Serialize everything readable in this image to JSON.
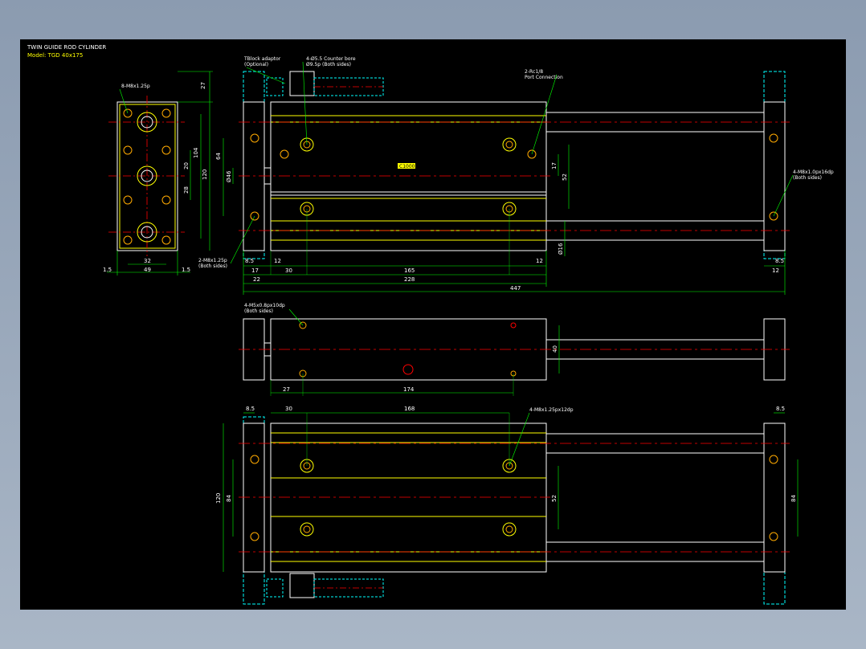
{
  "title": {
    "line1": "TWIN GUIDE ROD CYLINDER",
    "line2": "Model: TGD 40x175"
  },
  "colors": {
    "background": "#000000",
    "outline": "#ffffff",
    "centerline": "#ff0000",
    "dimension": "#00ff00",
    "body": "#ffff00",
    "hidden": "#00ffff",
    "hole": "#ffaa00"
  },
  "notes": {
    "end_holes": "8-M8x1.25p",
    "tblock": "TBlock adaptor",
    "tblock_sub": "(Optional)",
    "counter": "4-Ø5.5 Counter bore",
    "counter_sub": "Ø9.5p (Both sides)",
    "port": "2-Rc1/8",
    "port_sub": "Port Connection",
    "guide_taps": "4-M8x1.0px16dp",
    "guide_taps_sub": "(Both sides)",
    "side_taps": "2-M8x1.25p",
    "side_taps_sub": "(Both sides)",
    "top_taps": "4-M5x0.8px10dp",
    "top_taps_sub": "(Both sides)",
    "bottom_taps": "4-M8x1.25px12dp"
  },
  "dims": {
    "end": {
      "d27": "27",
      "d120": "120",
      "d104": "104",
      "d20": "20",
      "d28": "28",
      "d32": "32",
      "d49": "49",
      "d15a": "1.5",
      "d15b": "1.5"
    },
    "front": {
      "d64": "64",
      "d46": "Ø46",
      "d17v": "17",
      "d52": "52",
      "d16": "Ø16",
      "d85": "8.5",
      "d12a": "12",
      "d12b": "12",
      "d85r": "8.5",
      "d17": "17",
      "d30": "30",
      "d165": "165",
      "d22": "22",
      "d228": "228",
      "d12r": "12",
      "d447": "447"
    },
    "top": {
      "d40": "40",
      "d27": "27",
      "d174": "174"
    },
    "bottom": {
      "d85l": "8.5",
      "d30": "30",
      "d168": "168",
      "d85r": "8.5",
      "d120": "120",
      "d84": "84",
      "d52": "52",
      "d84r": "84"
    }
  },
  "badge": "C1000"
}
